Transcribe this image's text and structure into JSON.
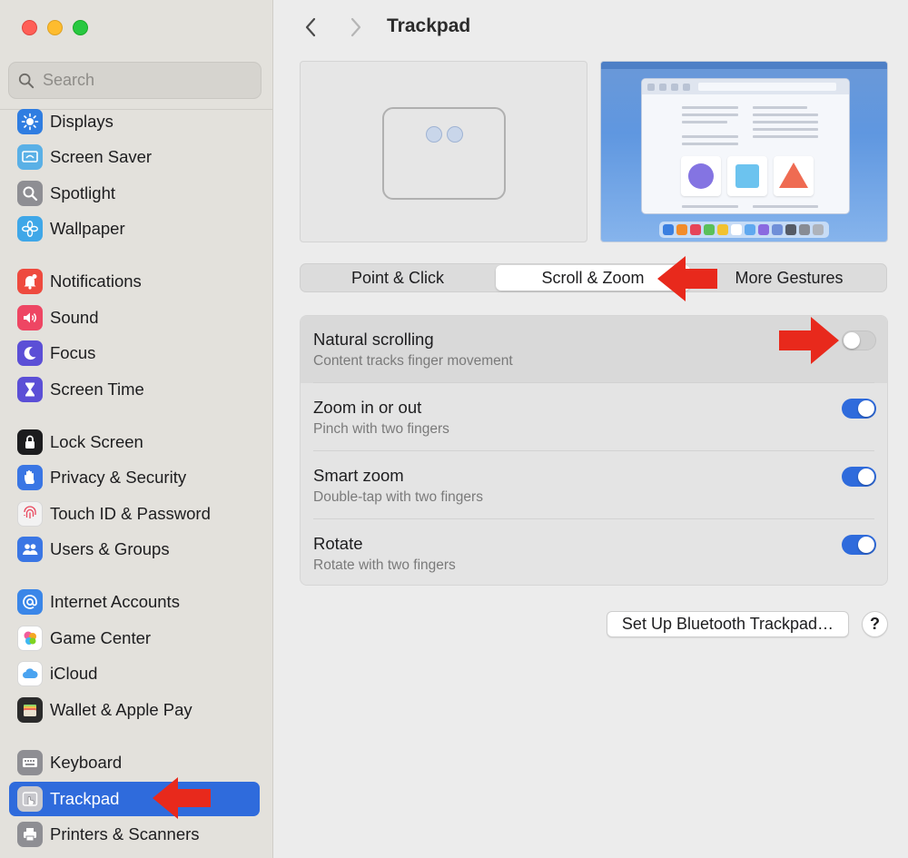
{
  "window": {
    "title": "Trackpad"
  },
  "search": {
    "placeholder": "Search"
  },
  "sidebar": {
    "items": [
      {
        "label": "Displays",
        "icon": "sun-icon",
        "color": "#2f7de1"
      },
      {
        "label": "Screen Saver",
        "icon": "screen-saver-icon",
        "color": "#5ab0e6"
      },
      {
        "label": "Spotlight",
        "icon": "magnifier-icon",
        "color": "#8e8e93"
      },
      {
        "label": "Wallpaper",
        "icon": "flower-icon",
        "color": "#3fa7e8"
      },
      {
        "label": "Notifications",
        "icon": "bell-icon",
        "color": "#ee4a3e"
      },
      {
        "label": "Sound",
        "icon": "speaker-icon",
        "color": "#ee4663"
      },
      {
        "label": "Focus",
        "icon": "moon-icon",
        "color": "#5b4fd6"
      },
      {
        "label": "Screen Time",
        "icon": "hourglass-icon",
        "color": "#5b4fd6"
      },
      {
        "label": "Lock Screen",
        "icon": "lock-icon",
        "color": "#1c1c1e"
      },
      {
        "label": "Privacy & Security",
        "icon": "hand-icon",
        "color": "#3a76e4"
      },
      {
        "label": "Touch ID & Password",
        "icon": "fingerprint-icon",
        "color": "#f2f2f2"
      },
      {
        "label": "Users & Groups",
        "icon": "users-icon",
        "color": "#3a76e4"
      },
      {
        "label": "Internet Accounts",
        "icon": "at-icon",
        "color": "#3a86e8"
      },
      {
        "label": "Game Center",
        "icon": "game-center-icon",
        "color": "#ffffff"
      },
      {
        "label": "iCloud",
        "icon": "cloud-icon",
        "color": "#ffffff"
      },
      {
        "label": "Wallet & Apple Pay",
        "icon": "wallet-icon",
        "color": "#2b2b2b"
      },
      {
        "label": "Keyboard",
        "icon": "keyboard-icon",
        "color": "#8e8e93"
      },
      {
        "label": "Trackpad",
        "icon": "trackpad-icon",
        "color": "#8e8e93",
        "selected": true
      },
      {
        "label": "Printers & Scanners",
        "icon": "printer-icon",
        "color": "#8e8e93"
      }
    ]
  },
  "tabs": [
    {
      "label": "Point & Click",
      "active": false
    },
    {
      "label": "Scroll & Zoom",
      "active": true
    },
    {
      "label": "More Gestures",
      "active": false
    }
  ],
  "settings": [
    {
      "title": "Natural scrolling",
      "subtitle": "Content tracks finger movement",
      "enabled": false
    },
    {
      "title": "Zoom in or out",
      "subtitle": "Pinch with two fingers",
      "enabled": true
    },
    {
      "title": "Smart zoom",
      "subtitle": "Double-tap with two fingers",
      "enabled": true
    },
    {
      "title": "Rotate",
      "subtitle": "Rotate with two fingers",
      "enabled": true
    }
  ],
  "buttons": {
    "bluetooth": "Set Up Bluetooth Trackpad…",
    "help": "?"
  },
  "colors": {
    "accent": "#2f6bdc",
    "annotation_arrow": "#e8291c"
  }
}
